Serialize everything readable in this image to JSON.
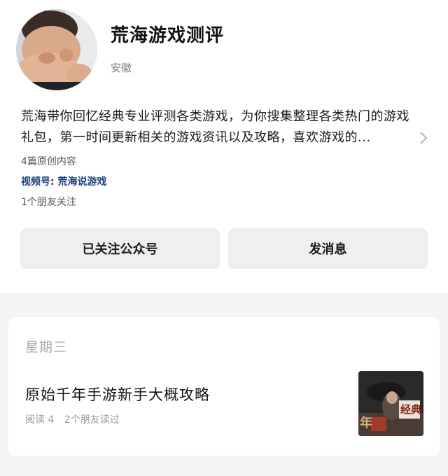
{
  "profile": {
    "name": "荒海游戏测评",
    "location": "安徽",
    "description": "荒海带你回忆经典专业评测各类游戏，为你搜集整理各类热门的游戏礼包，第一时间更新相关的游戏资讯以及攻略，喜欢游戏的...",
    "original_count": "4篇原创内容",
    "video_account": "视频号: 荒海说游戏",
    "friends_following": "1个朋友关注"
  },
  "actions": {
    "followed_label": "已关注公众号",
    "message_label": "发消息"
  },
  "article_list": {
    "day": "星期三",
    "articles": [
      {
        "title": "原始千年手游新手大概攻略",
        "reads": "阅读 4",
        "friends_read": "2个朋友读过",
        "thumbnail_text": "经典 年"
      }
    ]
  },
  "colors": {
    "page_bg": "#f4f4f4",
    "button_bg": "#efefef",
    "video_link": "#1f3f7a",
    "muted_text": "#9a9a9a"
  },
  "icons": {
    "expand": "chevron-right-icon"
  }
}
